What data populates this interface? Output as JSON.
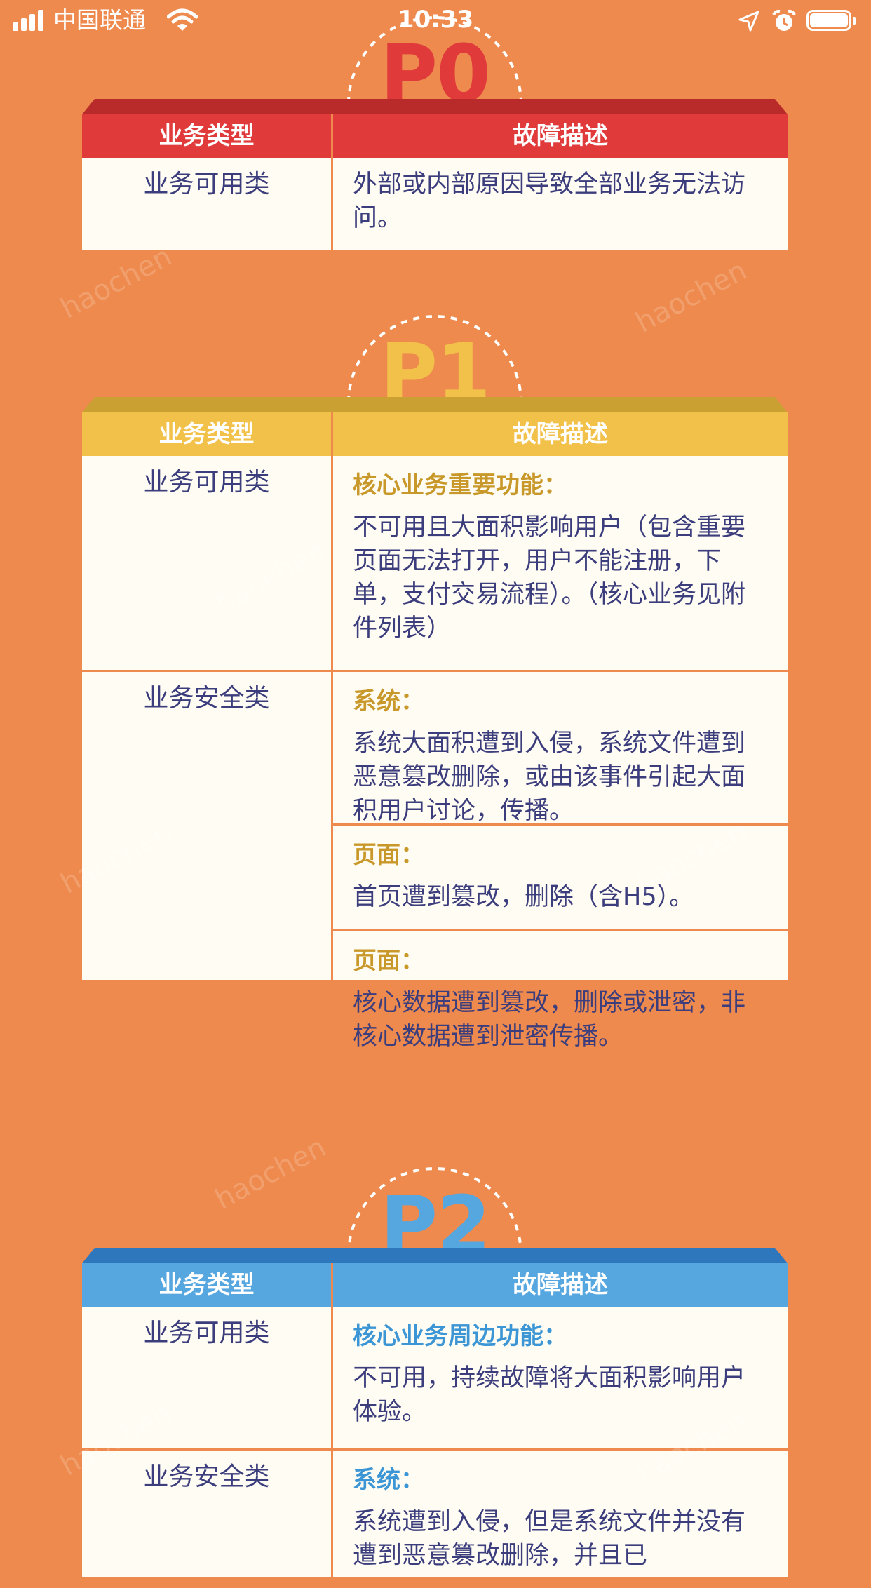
{
  "status_bar": {
    "carrier": "中国联通",
    "time": "10:33",
    "icons": [
      "signal-icon",
      "wifi-icon",
      "location-arrow-icon",
      "alarm-clock-icon",
      "battery-icon"
    ]
  },
  "colors": {
    "background": "#ee8a4e",
    "p0": "#e03a3b",
    "p1": "#f2c14a",
    "p2": "#56a6df",
    "text": "#3b3d7c",
    "cell_bg": "#fffdf3"
  },
  "watermark": "haochen",
  "headers": {
    "col1": "业务类型",
    "col2": "故障描述"
  },
  "sections": [
    {
      "level": "P0",
      "rows": [
        {
          "type": "业务可用类",
          "plain": "外部或内部原因导致全部业务无法访问。"
        }
      ]
    },
    {
      "level": "P1",
      "rows": [
        {
          "type": "业务可用类",
          "items": [
            {
              "heading": "核心业务重要功能：",
              "text": "不可用且大面积影响用户（包含重要页面无法打开，用户不能注册，下单，支付交易流程）。（核心业务见附件列表）"
            }
          ]
        },
        {
          "type": "业务安全类",
          "items": [
            {
              "heading": "系统：",
              "text": "系统大面积遭到入侵，系统文件遭到恶意篡改删除，或由该事件引起大面积用户讨论，传播。"
            },
            {
              "heading": "页面：",
              "text": "首页遭到篡改，删除（含H5）。"
            },
            {
              "heading": "页面：",
              "text": "核心数据遭到篡改，删除或泄密，非核心数据遭到泄密传播。"
            }
          ]
        }
      ]
    },
    {
      "level": "P2",
      "rows": [
        {
          "type": "业务可用类",
          "items": [
            {
              "heading": "核心业务周边功能：",
              "text": "不可用，持续故障将大面积影响用户体验。"
            }
          ]
        },
        {
          "type": "业务安全类",
          "items": [
            {
              "heading": "系统：",
              "text": "系统遭到入侵，但是系统文件并没有遭到恶意篡改删除，并且已"
            }
          ]
        }
      ]
    }
  ]
}
